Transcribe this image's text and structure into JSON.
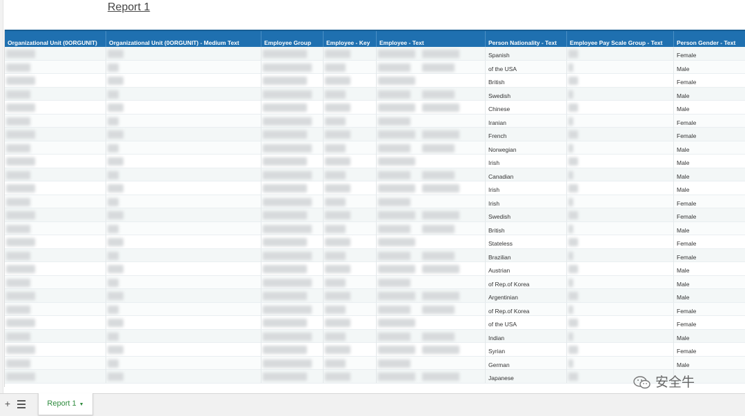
{
  "report": {
    "title": "Report 1"
  },
  "table": {
    "columns": [
      "Organizational Unit (0ORGUNIT)",
      "Organizational Unit (0ORGUNIT) - Medium Text",
      "Employee Group",
      "Employee - Key",
      "Employee - Text",
      "Person Nationality - Text",
      "Employee Pay Scale Group - Text",
      "Person Gender - Text"
    ],
    "rows": [
      {
        "nationality": "Spanish",
        "gender": "Female"
      },
      {
        "nationality": "of the USA",
        "gender": "Male"
      },
      {
        "nationality": "British",
        "gender": "Female"
      },
      {
        "nationality": "Swedish",
        "gender": "Male"
      },
      {
        "nationality": "Chinese",
        "gender": "Male"
      },
      {
        "nationality": "Iranian",
        "gender": "Female"
      },
      {
        "nationality": "French",
        "gender": "Female"
      },
      {
        "nationality": "Norwegian",
        "gender": "Male"
      },
      {
        "nationality": "Irish",
        "gender": "Male"
      },
      {
        "nationality": "Canadian",
        "gender": "Male"
      },
      {
        "nationality": "Irish",
        "gender": "Male"
      },
      {
        "nationality": "Irish",
        "gender": "Female"
      },
      {
        "nationality": "Swedish",
        "gender": "Female"
      },
      {
        "nationality": "British",
        "gender": "Male"
      },
      {
        "nationality": "Stateless",
        "gender": "Female"
      },
      {
        "nationality": "Brazilian",
        "gender": "Female"
      },
      {
        "nationality": "Austrian",
        "gender": "Male"
      },
      {
        "nationality": "of Rep.of Korea",
        "gender": "Male"
      },
      {
        "nationality": "Argentinian",
        "gender": "Male"
      },
      {
        "nationality": "of Rep.of Korea",
        "gender": "Female"
      },
      {
        "nationality": "of the USA",
        "gender": "Female"
      },
      {
        "nationality": "Indian",
        "gender": "Male"
      },
      {
        "nationality": "Syrian",
        "gender": "Female"
      },
      {
        "nationality": "German",
        "gender": "Male"
      },
      {
        "nationality": "Japanese",
        "gender": ""
      }
    ]
  },
  "sheets": {
    "add_label": "+",
    "active_tab": "Report 1",
    "caret": "▼"
  },
  "watermark": {
    "text": "安全牛"
  }
}
